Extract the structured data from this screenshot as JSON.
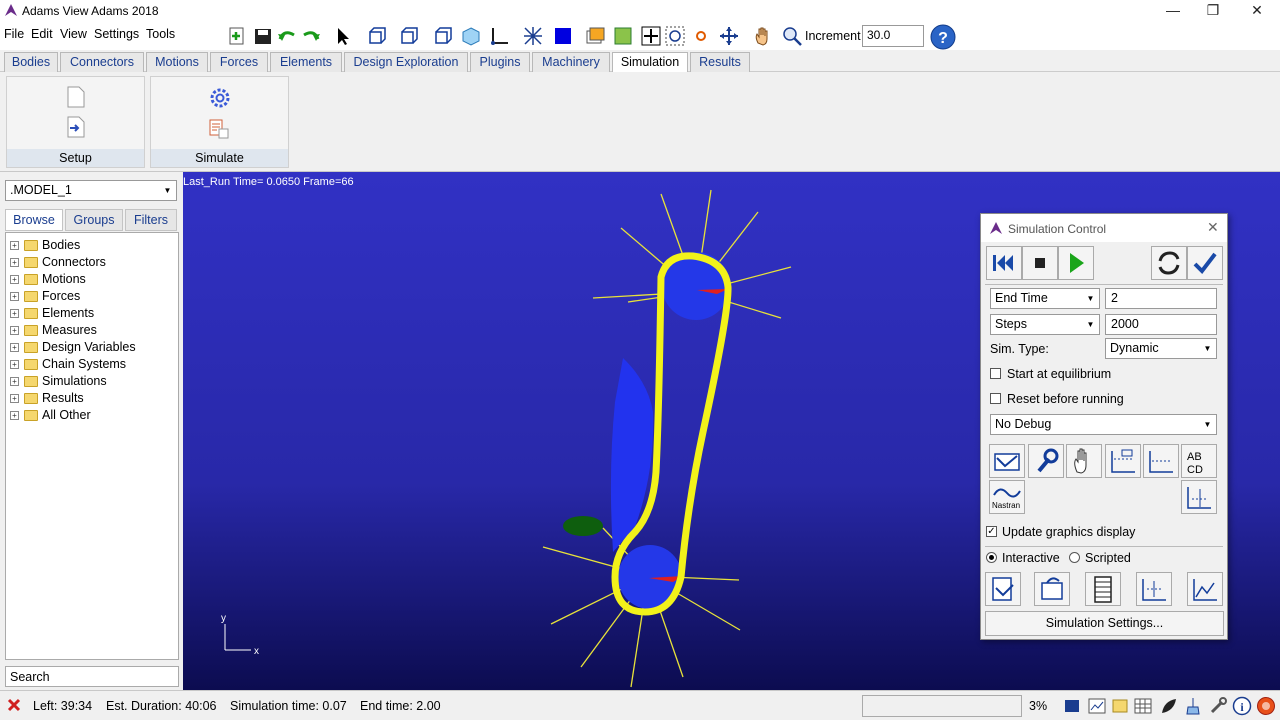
{
  "window": {
    "title": "Adams View Adams 2018"
  },
  "menu": [
    "File",
    "Edit",
    "View",
    "Settings",
    "Tools"
  ],
  "toolbar": {
    "increment_label": "Increment",
    "increment_value": "30.0"
  },
  "ribbon_tabs": [
    "Bodies",
    "Connectors",
    "Motions",
    "Forces",
    "Elements",
    "Design Exploration",
    "Plugins",
    "Machinery",
    "Simulation",
    "Results"
  ],
  "active_tab": "Simulation",
  "ribbon_groups": {
    "setup": "Setup",
    "simulate": "Simulate"
  },
  "browser": {
    "model": ".MODEL_1",
    "tabs": [
      "Browse",
      "Groups",
      "Filters"
    ],
    "tree": [
      "Bodies",
      "Connectors",
      "Motions",
      "Forces",
      "Elements",
      "Measures",
      "Design Variables",
      "Chain Systems",
      "Simulations",
      "Results",
      "All Other"
    ],
    "search": "Search"
  },
  "viewport": {
    "run_info": "Last_Run   Time= 0.0650  Frame=66",
    "axis_y": "y",
    "axis_x": "x"
  },
  "sim_control": {
    "title": "Simulation Control",
    "end_select": "End Time",
    "end_value": "2",
    "steps_select": "Steps",
    "steps_value": "2000",
    "sim_type_label": "Sim. Type:",
    "sim_type_value": "Dynamic",
    "start_equilibrium": "Start at equilibrium",
    "reset_before": "Reset before running",
    "debug": "No Debug",
    "nastran_label": "Nastran",
    "update_graphics": "Update graphics display",
    "interactive": "Interactive",
    "scripted": "Scripted",
    "settings_button": "Simulation Settings..."
  },
  "status": {
    "left": "Left: 39:34",
    "est_duration": "Est. Duration: 40:06",
    "sim_time": "Simulation time: 0.07",
    "end_time": "End time: 2.00",
    "percent": "3%"
  },
  "colors": {
    "viewport_top": "#3131c4",
    "chain": "#f2f21a",
    "sprocket": "#1f3fe8",
    "vector": "#f0e040"
  }
}
